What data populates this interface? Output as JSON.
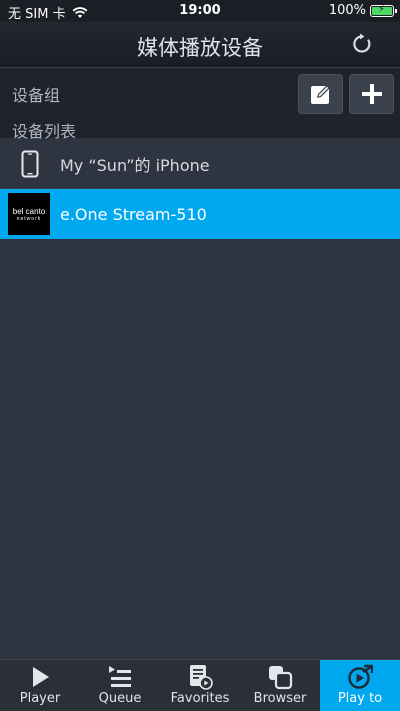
{
  "status_bar": {
    "carrier": "无 SIM 卡",
    "time": "19:00",
    "battery": "100%"
  },
  "header": {
    "title": "媒体播放设备",
    "refresh_icon": "refresh-icon"
  },
  "groups": {
    "group_label": "设备组",
    "list_label": "设备列表",
    "edit_icon": "edit-icon",
    "add_icon": "plus-icon"
  },
  "devices": [
    {
      "name": "My “Sun”的 iPhone",
      "icon": "phone-icon",
      "selected": false
    },
    {
      "name": "e.One Stream-510",
      "icon": "bel-canto-logo",
      "logo_line1": "bel canto",
      "logo_line2": "network",
      "selected": true
    }
  ],
  "tabs": [
    {
      "label": "Player",
      "icon": "play-icon",
      "active": false
    },
    {
      "label": "Queue",
      "icon": "queue-icon",
      "active": false
    },
    {
      "label": "Favorites",
      "icon": "favorites-icon",
      "active": false
    },
    {
      "label": "Browser",
      "icon": "browser-icon",
      "active": false
    },
    {
      "label": "Play to",
      "icon": "play-to-icon",
      "active": true
    }
  ],
  "colors": {
    "accent": "#00a8f0",
    "background": "#2e3440",
    "battery": "#4cd964"
  }
}
